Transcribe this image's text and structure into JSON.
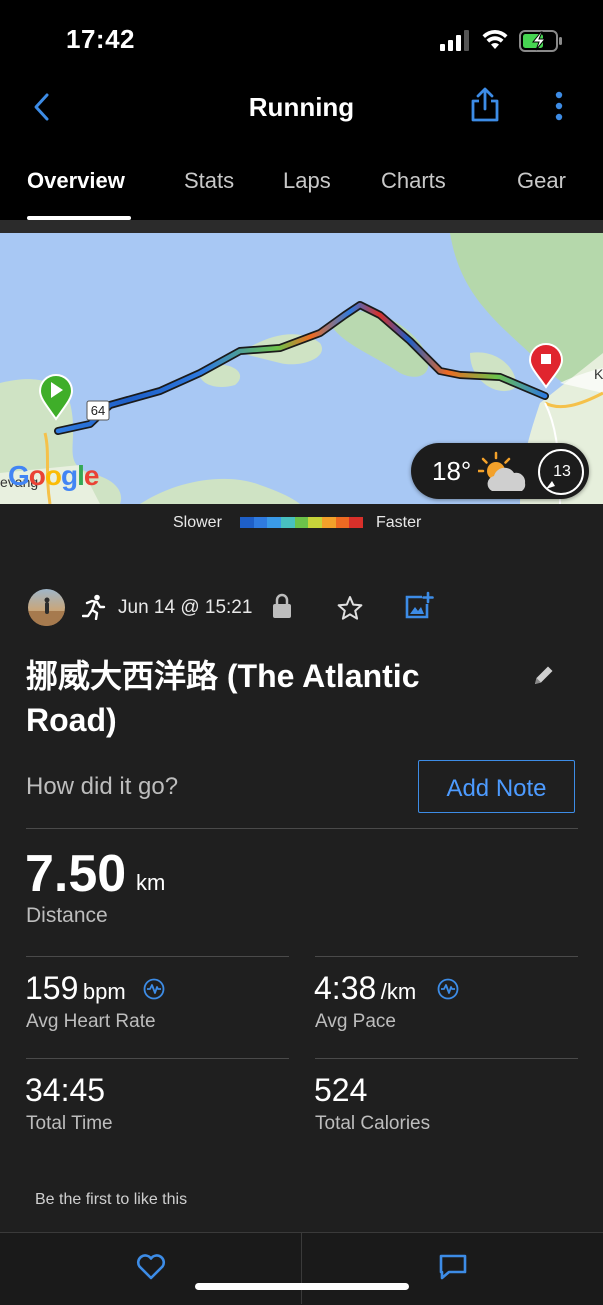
{
  "status_bar": {
    "time": "17:42"
  },
  "header": {
    "title": "Running"
  },
  "tabs": [
    "Overview",
    "Stats",
    "Laps",
    "Charts",
    "Gear"
  ],
  "map": {
    "road_number": "64",
    "map_label_left": "evang",
    "map_label_right": "K",
    "google_logo": "Google",
    "weather": {
      "temperature": "18°",
      "wind_speed": "13"
    }
  },
  "speed_legend": {
    "slower_label": "Slower",
    "faster_label": "Faster",
    "colors": [
      "#1e5fc8",
      "#2f7be0",
      "#3a9ae8",
      "#48c0c0",
      "#6cc24a",
      "#c6d43a",
      "#f3a12a",
      "#ee6a22",
      "#d9302a"
    ]
  },
  "activity": {
    "date": "Jun 14 @ 15:21",
    "name": "挪威大西洋路 (The Atlantic Road)",
    "prompt": "How did it go?",
    "add_note_label": "Add Note"
  },
  "stats": {
    "distance": {
      "value": "7.50",
      "unit": "km",
      "label": "Distance"
    },
    "heart_rate": {
      "value": "159",
      "unit": "bpm",
      "label": "Avg Heart Rate"
    },
    "pace": {
      "value": "4:38",
      "unit": "/km",
      "label": "Avg Pace"
    },
    "time": {
      "value": "34:45",
      "label": "Total Time"
    },
    "calories": {
      "value": "524",
      "label": "Total Calories"
    }
  },
  "social": {
    "likes_text": "Be the first to like this"
  },
  "colors": {
    "accent": "#3d8ce6",
    "background": "#1f1f1f",
    "start_pin": "#3fae29",
    "end_pin": "#e0252e"
  }
}
